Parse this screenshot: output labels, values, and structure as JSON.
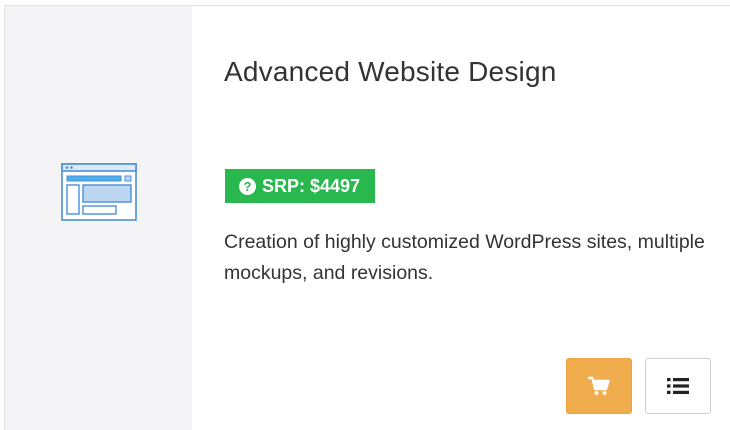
{
  "product": {
    "title": "Advanced Website Design",
    "icon": "website-layout-icon",
    "srp_label": "SRP: $4497",
    "description": "Creation of highly customized WordPress sites, multiple mockups, and revisions."
  },
  "actions": {
    "cart_icon": "shopping-cart-icon",
    "details_icon": "list-icon"
  },
  "colors": {
    "icon_panel_bg": "#f4f4f6",
    "badge_green": "#29b84e",
    "cart_orange": "#f0ad4e",
    "icon_blue": "#4a90d9",
    "text": "#333333"
  }
}
